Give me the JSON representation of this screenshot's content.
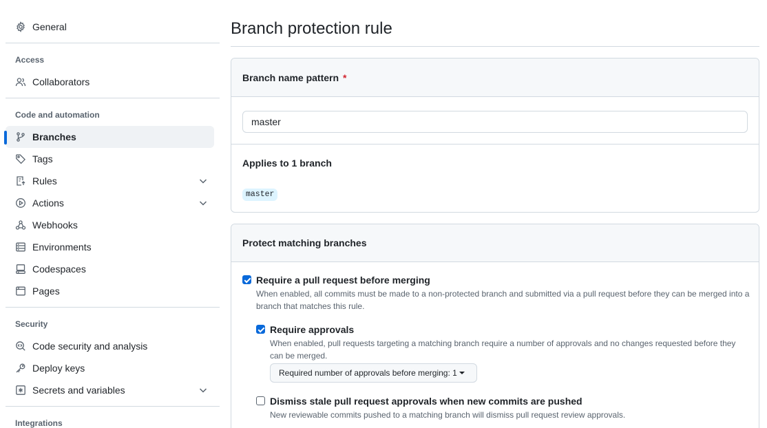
{
  "sidebar": {
    "general": "General",
    "sections": {
      "access": "Access",
      "code_automation": "Code and automation",
      "security": "Security",
      "integrations": "Integrations"
    },
    "items": {
      "collaborators": "Collaborators",
      "branches": "Branches",
      "tags": "Tags",
      "rules": "Rules",
      "actions": "Actions",
      "webhooks": "Webhooks",
      "environments": "Environments",
      "codespaces": "Codespaces",
      "pages": "Pages",
      "code_security": "Code security and analysis",
      "deploy_keys": "Deploy keys",
      "secrets": "Secrets and variables"
    },
    "active_item": "branches"
  },
  "main": {
    "title": "Branch protection rule",
    "pattern": {
      "label": "Branch name pattern",
      "required_mark": "*",
      "value": "master",
      "applies_text": "Applies to 1 branch",
      "matched_branch": "master"
    },
    "protect": {
      "heading": "Protect matching branches",
      "require_pr": {
        "checked": true,
        "label": "Require a pull request before merging",
        "desc": "When enabled, all commits must be made to a non-protected branch and submitted via a pull request before they can be merged into a branch that matches this rule."
      },
      "require_approvals": {
        "checked": true,
        "label": "Require approvals",
        "desc": "When enabled, pull requests targeting a matching branch require a number of approvals and no changes requested before they can be merged.",
        "select_label": "Required number of approvals before merging: 1"
      },
      "dismiss_stale": {
        "checked": false,
        "label": "Dismiss stale pull request approvals when new commits are pushed",
        "desc": "New reviewable commits pushed to a matching branch will dismiss pull request review approvals."
      }
    }
  },
  "colors": {
    "accent": "#0969da",
    "active_bg": "#eff2f5",
    "border": "#d1d9e0",
    "muted": "#59636e",
    "chip_bg": "#ddf4ff",
    "required": "#d1242f"
  }
}
